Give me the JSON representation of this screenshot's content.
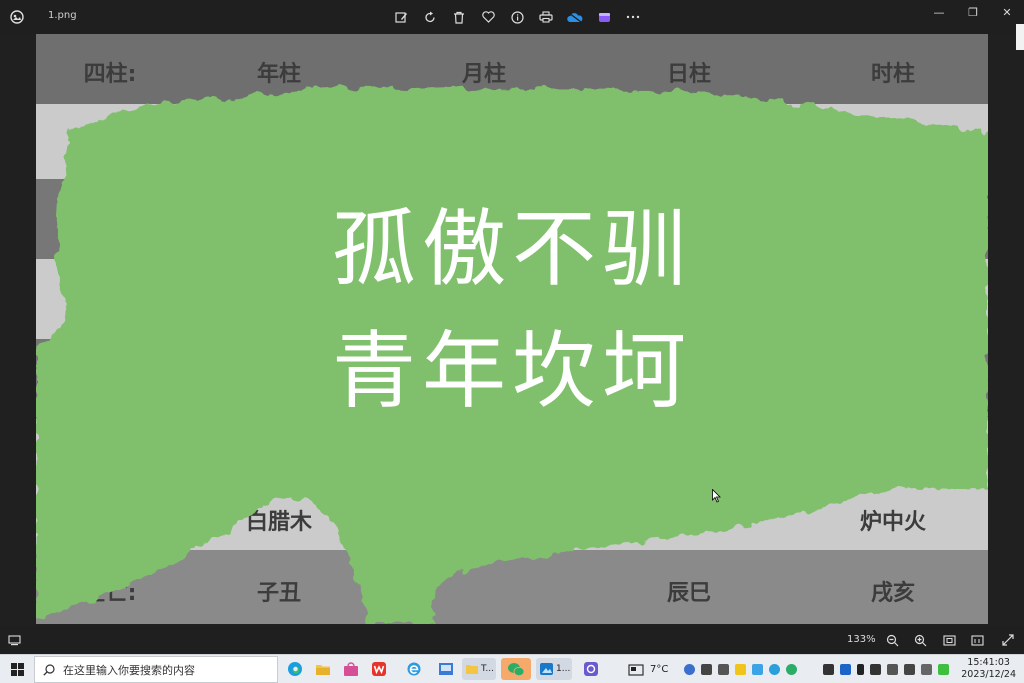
{
  "window": {
    "file_name": "1.png",
    "toolbar_icons": [
      "edit-icon",
      "rotate-icon",
      "delete-icon",
      "favorite-icon",
      "info-icon",
      "print-icon",
      "onedrive-icon",
      "clipchamp-icon",
      "more-icon"
    ],
    "controls": {
      "minimize": "—",
      "restore": "❐",
      "close": "✕"
    }
  },
  "image": {
    "header_row": {
      "label": "四柱:",
      "year": "年柱",
      "month": "月柱",
      "day": "日柱",
      "hour": "时柱"
    },
    "nayin_row": {
      "partial_left": "白腊木",
      "right": "炉中火"
    },
    "kongwang_row": {
      "label": "空亡:",
      "year": "子丑",
      "day": "辰巳",
      "hour": "戌亥"
    },
    "overlay": {
      "line1": "孤傲不驯",
      "line2": "青年坎坷",
      "color": "#80c06c"
    }
  },
  "viewbar": {
    "zoom": "133%"
  },
  "taskbar": {
    "search_placeholder": "在这里输入你要搜索的内容",
    "apps": [
      {
        "name": "edge",
        "label": ""
      },
      {
        "name": "file-explorer",
        "label": ""
      },
      {
        "name": "store",
        "label": ""
      },
      {
        "name": "wps",
        "label": ""
      },
      {
        "name": "ie",
        "label": ""
      },
      {
        "name": "app-blue",
        "label": ""
      },
      {
        "name": "folder-t",
        "label": "T..."
      },
      {
        "name": "wechat",
        "label": ""
      },
      {
        "name": "photos",
        "label": "1..."
      },
      {
        "name": "app-purple",
        "label": ""
      }
    ],
    "weather": "7°C",
    "time": "15:41:03",
    "date": "2023/12/24"
  }
}
